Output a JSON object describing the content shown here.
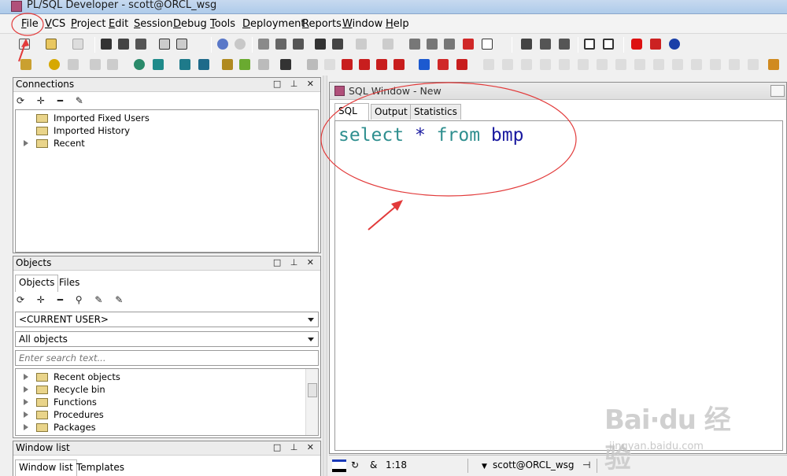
{
  "window": {
    "title": "PL/SQL Developer - scott@ORCL_wsg"
  },
  "menu": [
    "File",
    "VCS",
    "Project",
    "Edit",
    "Session",
    "Debug",
    "Tools",
    "Deployment",
    "Reports",
    "Window",
    "Help"
  ],
  "connections": {
    "title": "Connections",
    "items": [
      "Imported Fixed Users",
      "Imported History",
      "Recent"
    ]
  },
  "objects": {
    "title": "Objects",
    "tabs": [
      "Objects",
      "Files"
    ],
    "user_select": "<CURRENT USER>",
    "filter_select": "All objects",
    "search_placeholder": "Enter search text...",
    "items": [
      "Recent objects",
      "Recycle bin",
      "Functions",
      "Procedures",
      "Packages"
    ]
  },
  "window_list": {
    "title": "Window list",
    "tabs": [
      "Window list",
      "Templates"
    ]
  },
  "sql_window": {
    "title": "SQL Window - New",
    "tabs": [
      "SQL",
      "Output",
      "Statistics"
    ],
    "code": {
      "kw1": "select",
      "op": "*",
      "kw2": "from",
      "ident": "bmp"
    }
  },
  "status": {
    "position": "1:18",
    "connection": "scott@ORCL_wsg"
  },
  "watermark": {
    "brand": "Bai·du 经验",
    "url": "jingyan.baidu.com"
  },
  "colors": {
    "keyword": "#2f8f8f",
    "identifier": "#1a1aa0",
    "annotation": "#e23a3a"
  }
}
